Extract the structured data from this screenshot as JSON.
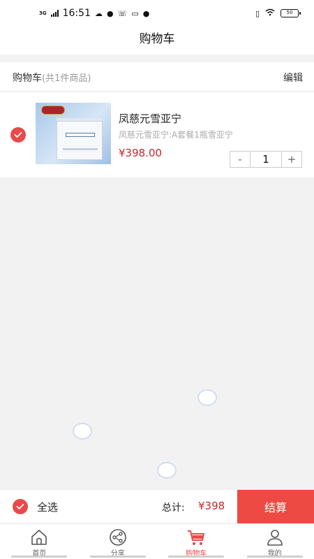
{
  "status_bar": {
    "network": "3G",
    "time": "16:51",
    "battery": "50"
  },
  "header": {
    "title": "购物车"
  },
  "cart": {
    "label": "购物车",
    "count_text": "(共1件商品)",
    "edit_label": "编辑",
    "items": [
      {
        "name": "凤慈元雪亚宁",
        "spec": "凤慈元雪亚宁:A套餐1瓶雪亚宁",
        "price": "¥398.00",
        "quantity": "1",
        "selected": true
      }
    ]
  },
  "stepper": {
    "minus": "-",
    "plus": "+"
  },
  "checkout": {
    "select_all_label": "全选",
    "total_label": "总计:",
    "total_value": "¥398",
    "button_label": "结算"
  },
  "tabs": [
    {
      "label": "首页",
      "icon": "home-icon",
      "active": false
    },
    {
      "label": "分享",
      "icon": "share-icon",
      "active": false
    },
    {
      "label": "购物车",
      "icon": "cart-icon",
      "active": true
    },
    {
      "label": "我的",
      "icon": "user-icon",
      "active": false
    }
  ],
  "colors": {
    "accent": "#e84a4a",
    "price": "#c1272d",
    "checkout_button": "#ee4a44"
  }
}
